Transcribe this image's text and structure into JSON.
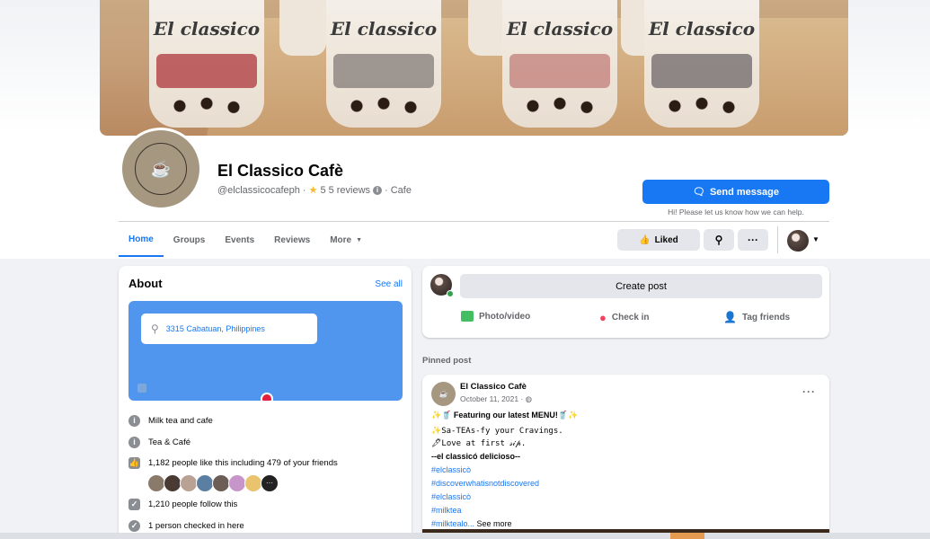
{
  "page": {
    "name": "El Classico Cafè",
    "handle": "@elclassicocafeph",
    "rating": "5",
    "reviews": "5 reviews",
    "category": "Cafe",
    "cover_brand": "El classico"
  },
  "actions": {
    "send_message": "Send message",
    "send_hint": "Hi! Please let us know how we can help.",
    "liked": "Liked"
  },
  "tabs": [
    {
      "label": "Home",
      "active": true
    },
    {
      "label": "Groups"
    },
    {
      "label": "Events"
    },
    {
      "label": "Reviews"
    },
    {
      "label": "More"
    }
  ],
  "about": {
    "title": "About",
    "see_all": "See all",
    "address": "3315 Cabatuan, Philippines",
    "items": [
      {
        "icon": "info-icon",
        "text": "Milk tea and cafe"
      },
      {
        "icon": "info-icon",
        "text": "Tea & Café"
      },
      {
        "icon": "thumbs-up-icon",
        "text": "1,182 people like this including 479 of your friends"
      },
      {
        "icon": "follow-icon",
        "text": "1,210 people follow this"
      },
      {
        "icon": "check-in-icon",
        "text": "1 person checked in here"
      }
    ]
  },
  "composer": {
    "create_post": "Create post",
    "photo_video": "Photo/video",
    "check_in": "Check in",
    "tag_friends": "Tag friends"
  },
  "pinned_label": "Pinned post",
  "post": {
    "author": "El Classico Cafè",
    "date": "October 11, 2021 ·",
    "lines": [
      "✨🥤 Featuring our latest MENU!🥤✨",
      "✨Sa-TEAs-fy your Cravings.",
      "🖋Love at first 𝓈𝒾𝓅.",
      "--el classicó delicioso--",
      "#elclassicò",
      "#discoverwhatisnotdiscovered",
      "#elclassicò",
      "#milktea",
      "#milktealo..."
    ],
    "see_more": "See more"
  },
  "colors": {
    "brand_blue": "#1877f2",
    "background": "#f0f2f5",
    "map_blue": "#5196ee",
    "online_green": "#31a24c"
  }
}
